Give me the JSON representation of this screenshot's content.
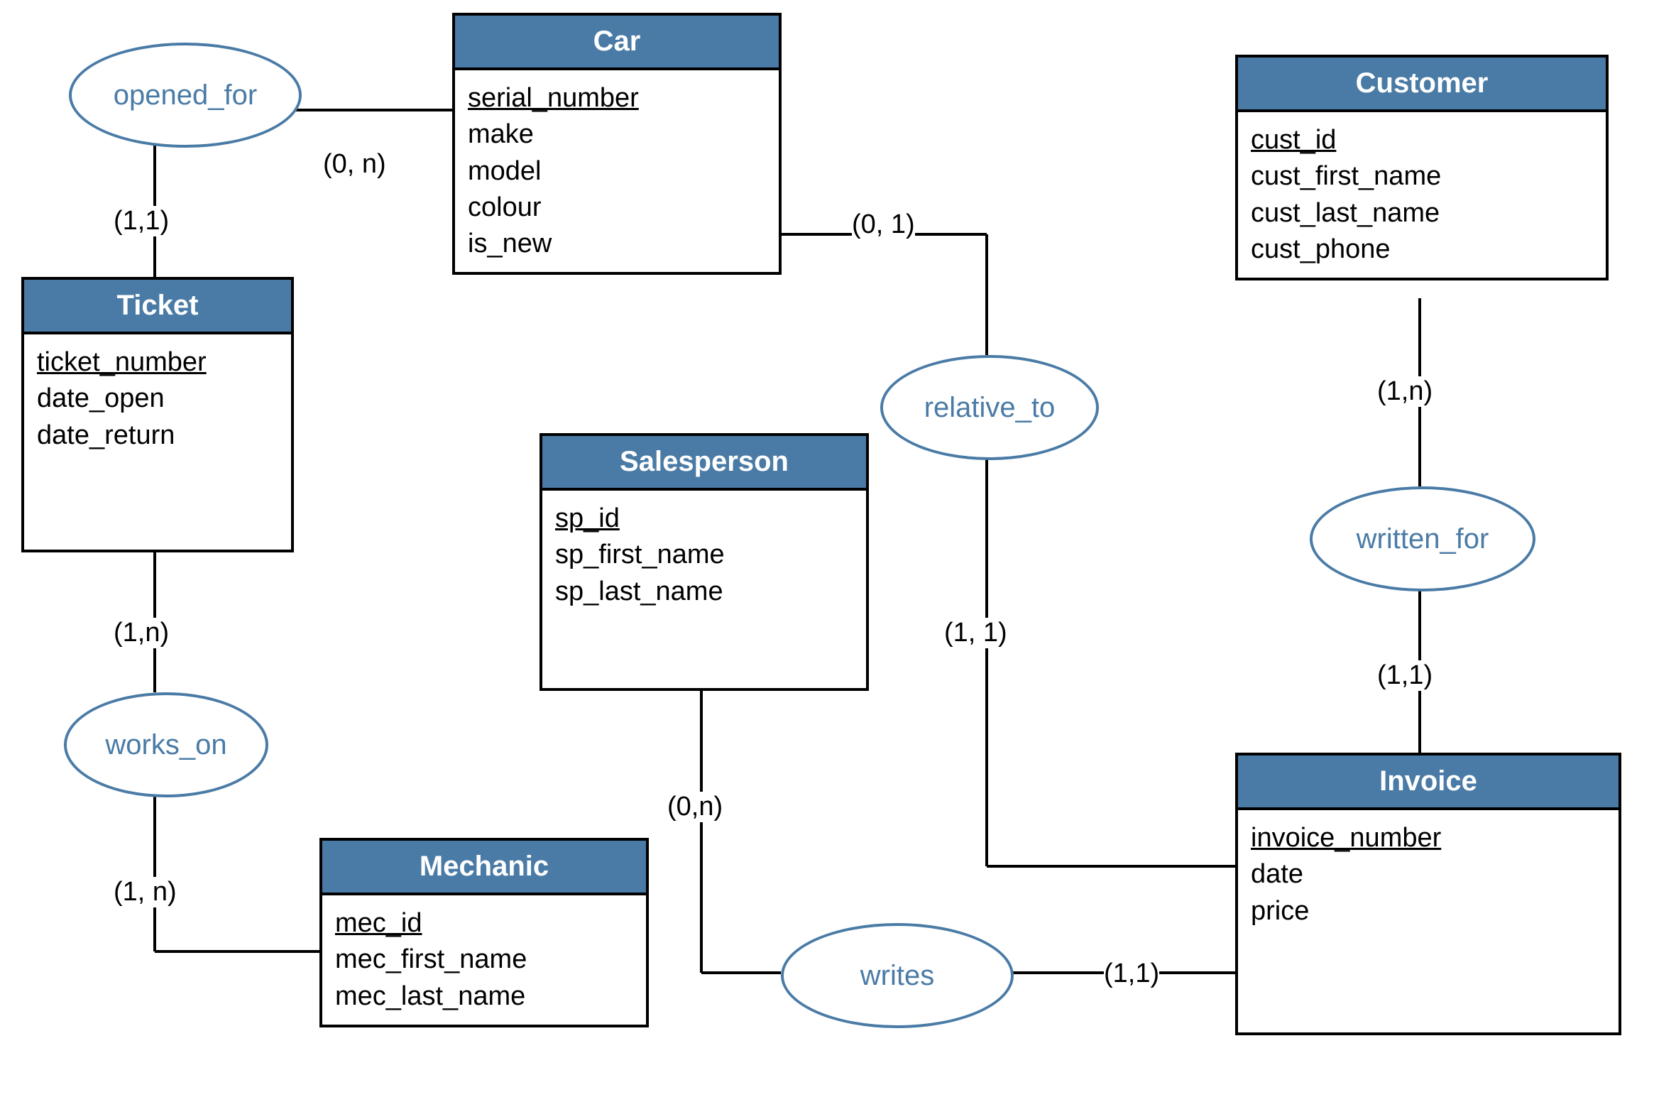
{
  "entities": {
    "car": {
      "title": "Car",
      "attrs": [
        "serial_number",
        "make",
        "model",
        "colour",
        "is_new"
      ],
      "key": "serial_number"
    },
    "customer": {
      "title": "Customer",
      "attrs": [
        "cust_id",
        "cust_first_name",
        "cust_last_name",
        "cust_phone"
      ],
      "key": "cust_id"
    },
    "ticket": {
      "title": "Ticket",
      "attrs": [
        "ticket_number",
        "date_open",
        "date_return"
      ],
      "key": "ticket_number"
    },
    "salesperson": {
      "title": "Salesperson",
      "attrs": [
        "sp_id",
        "sp_first_name",
        "sp_last_name"
      ],
      "key": "sp_id"
    },
    "mechanic": {
      "title": "Mechanic",
      "attrs": [
        "mec_id",
        "mec_first_name",
        "mec_last_name"
      ],
      "key": "mec_id"
    },
    "invoice": {
      "title": "Invoice",
      "attrs": [
        "invoice_number",
        "date",
        "price"
      ],
      "key": "invoice_number"
    }
  },
  "relationships": {
    "opened_for": "opened_for",
    "relative_to": "relative_to",
    "written_for": "written_for",
    "works_on": "works_on",
    "writes": "writes"
  },
  "cardinalities": {
    "opened_for_car": "(0, n)",
    "opened_for_ticket": "(1,1)",
    "relative_to_car": "(0, 1)",
    "relative_to_invoice": "(1, 1)",
    "written_for_customer": "(1,n)",
    "written_for_invoice": "(1,1)",
    "works_on_ticket": "(1,n)",
    "works_on_mechanic": "(1, n)",
    "writes_salesperson": "(0,n)",
    "writes_invoice": "(1,1)"
  }
}
